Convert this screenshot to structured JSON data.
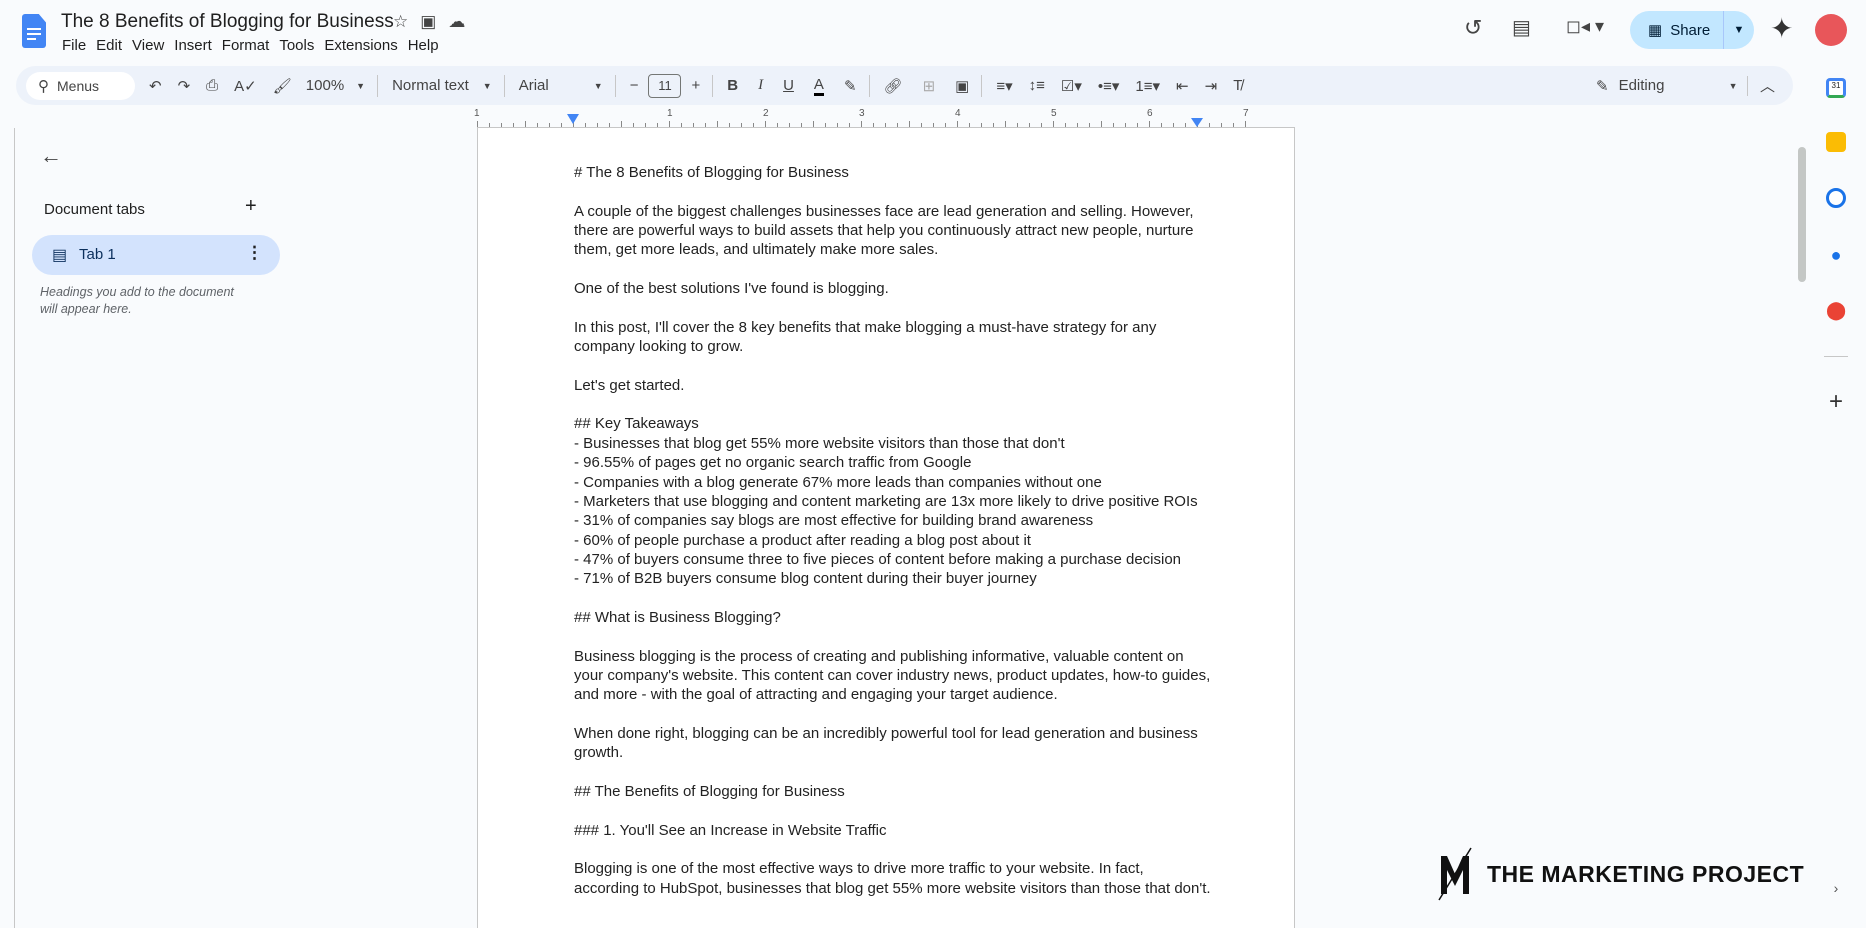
{
  "app": {
    "title": "The 8 Benefits of Blogging for Business",
    "menu": [
      "File",
      "Edit",
      "View",
      "Insert",
      "Format",
      "Tools",
      "Extensions",
      "Help"
    ],
    "share_label": "Share",
    "brand_color": "#4285f4",
    "share_bg": "#c2e7ff"
  },
  "toolbar": {
    "search": "Menus",
    "zoom": "100%",
    "style": "Normal text",
    "font": "Arial",
    "font_size": "11",
    "mode": "Editing"
  },
  "ruler": [
    "1",
    "1",
    "2",
    "3",
    "4",
    "5",
    "6",
    "7"
  ],
  "sidebar": {
    "section": "Document tabs",
    "tab": "Tab 1",
    "hint1": "Headings you add to the document",
    "hint2": "will appear here."
  },
  "document": {
    "lines": [
      "# The 8 Benefits of Blogging for Business",
      "",
      "A couple of the biggest challenges businesses face are lead generation and selling. However,",
      "there are powerful ways to build assets that help you continuously attract new people, nurture",
      "them, get more leads, and ultimately make more sales.",
      "",
      "One of the best solutions I've found is blogging.",
      "",
      "In this post, I'll cover the 8 key benefits that make blogging a must-have strategy for any",
      "company looking to grow.",
      "",
      "Let's get started.",
      "",
      "## Key Takeaways",
      "- Businesses that blog get 55% more website visitors than those that don't",
      "- 96.55% of pages get no organic search traffic from Google",
      "- Companies with a blog generate 67% more leads than companies without one",
      "- Marketers that use blogging and content marketing are 13x more likely to drive positive ROIs",
      "- 31% of companies say blogs are most effective for building brand awareness",
      "- 60% of people purchase a product after reading a blog post about it",
      "- 47% of buyers consume three to five pieces of content before making a purchase decision",
      "- 71% of B2B buyers consume blog content during their buyer journey",
      "",
      "## What is Business Blogging?",
      "",
      "Business blogging is the process of creating and publishing informative, valuable content on",
      "your company's website. This content can cover industry news, product updates, how-to guides,",
      "and more - with the goal of attracting and engaging your target audience.",
      "",
      "When done right, blogging can be an incredibly powerful tool for lead generation and business",
      "growth.",
      "",
      "## The Benefits of Blogging for Business",
      "",
      "### 1. You'll See an Increase in Website Traffic",
      "",
      "Blogging is one of the most effective ways to drive more traffic to your website. In fact,",
      "according to HubSpot, businesses that blog get 55% more website visitors than those that don't."
    ]
  },
  "watermark": "THE MARKETING PROJECT"
}
